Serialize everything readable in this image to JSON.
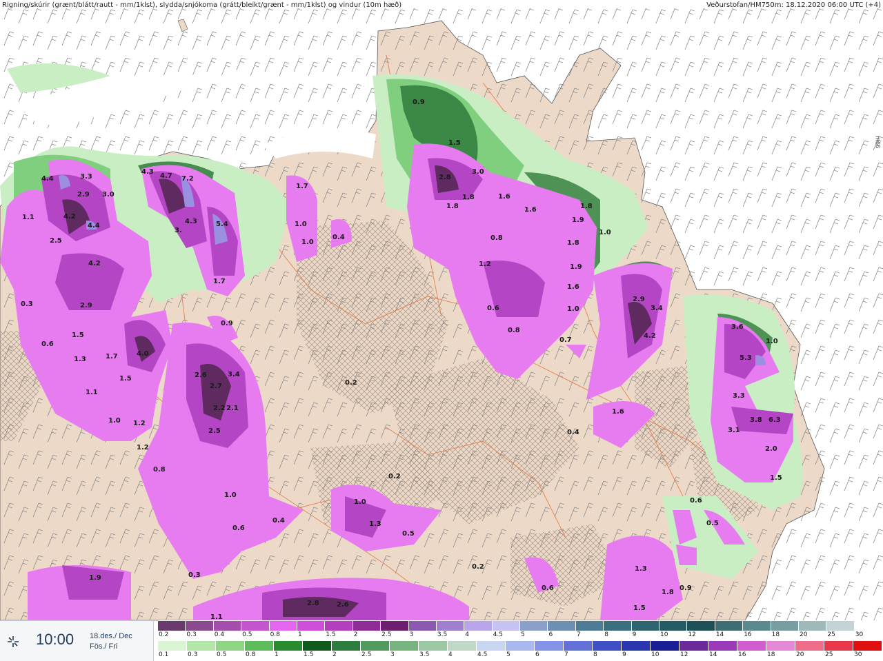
{
  "header": {
    "left": "Rigning/skúrir (grænt/blátt/rautt - mm/1klst), slydda/snjókoma (grátt/bleikt/grænt - mm/1klst) og vindur (10m hæð)",
    "right": "Veðurstofan/HM750m: 18.12.2020 06:00 UTC (+4)",
    "side": "m66"
  },
  "colors": {
    "sea": "#ffffff",
    "land": "#ecd9c8",
    "green_light": "#c9eec3",
    "green_mid": "#7fcf7e",
    "green_dark": "#2f7a3b",
    "purple_light": "#e67cf0",
    "purple_mid": "#b445c4",
    "purple_dark": "#5e2a60",
    "lavender": "#9a8fe0",
    "roads": "#e07a48"
  },
  "map_values": [
    "4.4",
    "3.3",
    "2.9",
    "3.0",
    "4.2",
    "4.4",
    "1.1",
    "2.5",
    "4.2",
    "2.9",
    "0.3",
    "0.6",
    "1.5",
    "1.3",
    "1.7",
    "4.0",
    "1.5",
    "1.1",
    "1.0",
    "1.2",
    "1.2",
    "0.8",
    "4.3",
    "4.7",
    "7.2",
    "5.4",
    "4.3",
    "3.",
    "1.7",
    "0.9",
    "2.6",
    "2.7",
    "3.4",
    "2.2",
    "2.1",
    "2.5",
    "1.0",
    "0.6",
    "0.4",
    "0.3",
    "1.7",
    "1.0",
    "1.0",
    "0.4",
    "0.9",
    "1.5",
    "2.8",
    "3.0",
    "1.8",
    "1.8",
    "1.6",
    "1.6",
    "1.8",
    "1.9",
    "1.0",
    "1.8",
    "0.8",
    "1.2",
    "1.9",
    "1.6",
    "1.0",
    "0.6",
    "0.8",
    "0.7",
    "2.9",
    "3.4",
    "4.2",
    "1.6",
    "0.4",
    "3.6",
    "1.0",
    "5.3",
    "3.3",
    "3.8",
    "6.3",
    "3.1",
    "2.0",
    "1.5",
    "0.2",
    "0.2",
    "1.0",
    "1.3",
    "0.5",
    "0.2",
    "0.6",
    "1.9",
    "2.8",
    "2.6",
    "1.1",
    "1.3",
    "1.8",
    "1.5",
    "0.9",
    "0.5",
    "0.6"
  ],
  "timebox": {
    "logo": "vedur-logo-icon",
    "time": "10:00",
    "date_line1": "18.des./ Dec",
    "date_line2": "Fös./ Fri"
  },
  "legend": {
    "row1": {
      "labels": [
        "0.2",
        "0.3",
        "0.4",
        "0.5",
        "0.8",
        "1",
        "1.5",
        "2",
        "2.5",
        "3",
        "3.5",
        "4",
        "4.5",
        "5",
        "6",
        "7",
        "8",
        "9",
        "10",
        "12",
        "14",
        "16",
        "18",
        "20",
        "25",
        "30"
      ],
      "colors": [
        "#6a3a6c",
        "#8b4a8e",
        "#a24eaa",
        "#c455cf",
        "#e466ee",
        "#d04fd8",
        "#b43fbe",
        "#8e2d96",
        "#6c1f70",
        "#8a5ab0",
        "#a07fd0",
        "#b8a6e8",
        "#c7c3f0",
        "#8aa0c8",
        "#6f8fb2",
        "#4e7c96",
        "#3b6f80",
        "#2e6470",
        "#245a62",
        "#1f5058",
        "#3e6e74",
        "#5a8a8e",
        "#789ea2",
        "#9fb8ba",
        "#c4d4d6",
        "#ffffff"
      ]
    },
    "row2": {
      "labels": [
        "0.1",
        "0.3",
        "0.5",
        "0.8",
        "1",
        "1.5",
        "2",
        "2.5",
        "3",
        "3.5",
        "4",
        "4.5",
        "5",
        "6",
        "7",
        "8",
        "9",
        "10",
        "12",
        "14",
        "16",
        "18",
        "20",
        "25",
        "30"
      ],
      "colors": [
        "#d9f5d3",
        "#b4e6a9",
        "#8fd684",
        "#5ebc5a",
        "#2a8a2e",
        "#0f5a1a",
        "#2d7d3e",
        "#4f9a5c",
        "#76b37e",
        "#9cc8a4",
        "#c0d9c6",
        "#c8d6f2",
        "#a9b8ee",
        "#8594e6",
        "#6270d8",
        "#3f4fc8",
        "#2a36b0",
        "#1a1e94",
        "#6a2a9a",
        "#9a3ab8",
        "#d15ed0",
        "#e489d6",
        "#ef6c8a",
        "#e8364a",
        "#e01010"
      ]
    }
  }
}
